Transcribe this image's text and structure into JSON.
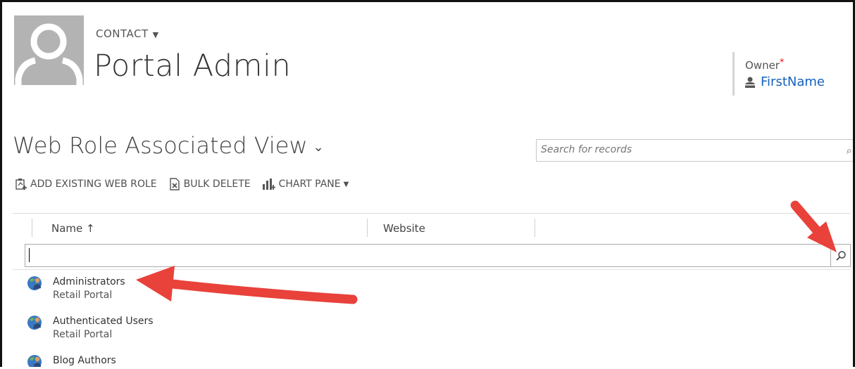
{
  "header": {
    "entity_type": "CONTACT",
    "record_name": "Portal Admin",
    "owner_label": "Owner",
    "owner_required_mark": "*",
    "owner_value": "FirstName"
  },
  "view": {
    "title": "Web Role Associated View",
    "search_placeholder": "Search for records"
  },
  "commands": [
    {
      "label": "ADD EXISTING WEB ROLE",
      "icon": "add-existing-icon"
    },
    {
      "label": "BULK DELETE",
      "icon": "bulk-delete-icon"
    },
    {
      "label": "CHART PANE",
      "icon": "chart-icon"
    }
  ],
  "grid": {
    "columns": [
      "Name ↑",
      "Website"
    ],
    "filter_value": "",
    "rows": [
      {
        "name": "Administrators",
        "website": "Retail Portal"
      },
      {
        "name": "Authenticated Users",
        "website": "Retail Portal"
      },
      {
        "name": "Blog Authors",
        "website": ""
      }
    ]
  },
  "colors": {
    "accent_link": "#1560bd",
    "annotation_arrow": "#e8423b",
    "avatar_bg": "#b3b3b3"
  }
}
